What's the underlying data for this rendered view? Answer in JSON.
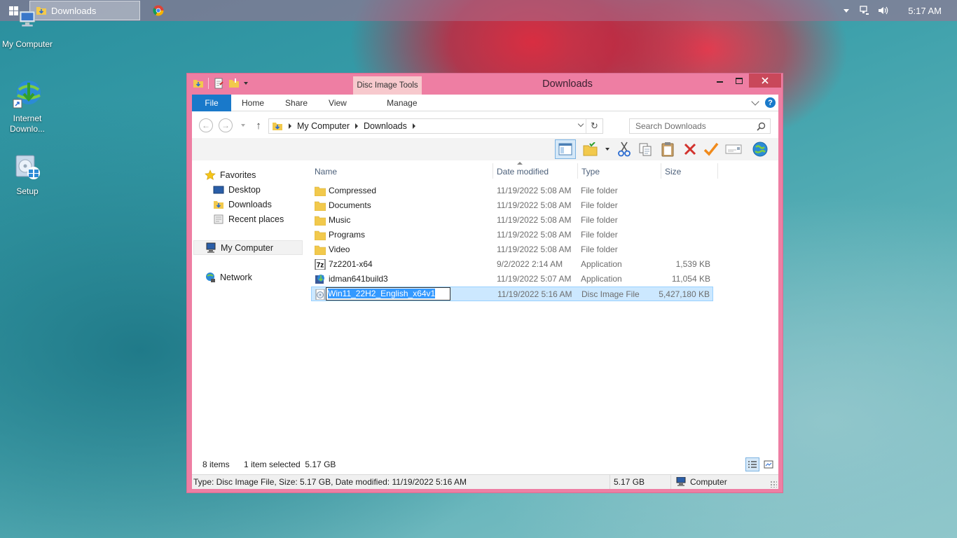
{
  "taskbar": {
    "active_window_label": "Downloads",
    "clock": "5:17 AM"
  },
  "desktop": {
    "icons": [
      {
        "label": "My Computer"
      },
      {
        "label": "Internet Downlo..."
      },
      {
        "label": "Setup"
      }
    ]
  },
  "window": {
    "title": "Downloads",
    "contextual_tab": "Disc Image Tools",
    "ribbon_tabs": {
      "file": "File",
      "home": "Home",
      "share": "Share",
      "view": "View",
      "manage": "Manage"
    },
    "address": {
      "crumbs": [
        "My Computer",
        "Downloads"
      ]
    },
    "search": {
      "placeholder": "Search Downloads"
    },
    "nav": {
      "favorites": "Favorites",
      "desktop": "Desktop",
      "downloads": "Downloads",
      "recent": "Recent places",
      "computer": "My Computer",
      "network": "Network"
    },
    "columns": {
      "name": "Name",
      "date": "Date modified",
      "type": "Type",
      "size": "Size"
    },
    "files": [
      {
        "name": "Compressed",
        "date": "11/19/2022 5:08 AM",
        "type": "File folder",
        "size": "",
        "icon": "folder-icon"
      },
      {
        "name": "Documents",
        "date": "11/19/2022 5:08 AM",
        "type": "File folder",
        "size": "",
        "icon": "folder-icon"
      },
      {
        "name": "Music",
        "date": "11/19/2022 5:08 AM",
        "type": "File folder",
        "size": "",
        "icon": "folder-icon"
      },
      {
        "name": "Programs",
        "date": "11/19/2022 5:08 AM",
        "type": "File folder",
        "size": "",
        "icon": "folder-icon"
      },
      {
        "name": "Video",
        "date": "11/19/2022 5:08 AM",
        "type": "File folder",
        "size": "",
        "icon": "folder-icon"
      },
      {
        "name": "7z2201-x64",
        "date": "9/2/2022 2:14 AM",
        "type": "Application",
        "size": "1,539 KB",
        "icon": "7zip-icon"
      },
      {
        "name": "idman641build3",
        "date": "11/19/2022 5:07 AM",
        "type": "Application",
        "size": "11,054 KB",
        "icon": "idm-installer-icon"
      },
      {
        "name": "Win11_22H2_English_x64v1",
        "date": "11/19/2022 5:16 AM",
        "type": "Disc Image File",
        "size": "5,427,180 KB",
        "icon": "disc-image-icon",
        "selected": true,
        "renaming": true
      }
    ],
    "status": {
      "items": "8 items",
      "selected": "1 item selected  5.17 GB"
    },
    "details_bar": {
      "info": "Type: Disc Image File, Size: 5.17 GB, Date modified: 11/19/2022 5:16 AM",
      "size": "5.17 GB",
      "location": "Computer"
    }
  },
  "colors": {
    "accent": "#1979ca",
    "window_frame": "#ee7ea3",
    "selection": "#cce8ff",
    "close_button": "#c9485a"
  }
}
